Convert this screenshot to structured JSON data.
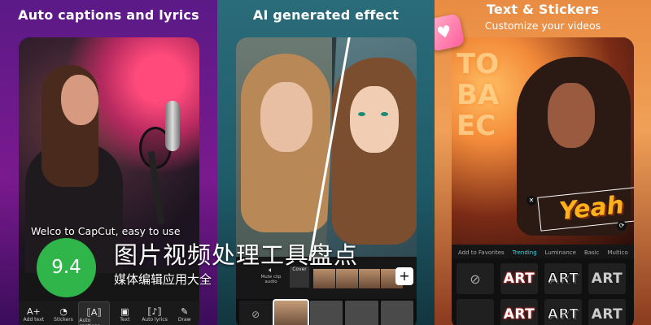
{
  "panels": [
    {
      "title": "Auto captions and lyrics",
      "caption_text": "Welco   to CapCut, easy to use",
      "toolbar": [
        {
          "icon": "text-add-icon",
          "glyph": "A+",
          "label": "Add text"
        },
        {
          "icon": "sticker-icon",
          "glyph": "◔",
          "label": "Stickers"
        },
        {
          "icon": "auto-captions-icon",
          "glyph": "⟦A⟧",
          "label": "Auto captions"
        },
        {
          "icon": "text-icon",
          "glyph": "▣",
          "label": "Text"
        },
        {
          "icon": "auto-lyrics-icon",
          "glyph": "⟦♪⟧",
          "label": "Auto lyrics"
        },
        {
          "icon": "draw-icon",
          "glyph": "✎",
          "label": "Draw"
        }
      ]
    },
    {
      "title": "AI generated effect",
      "mute_label": "Mute clip audio",
      "cover_label": "Cover"
    },
    {
      "title": "Text & Stickers",
      "subtitle": "Customize your videos",
      "sticker_text": "Yeah",
      "tabs": [
        "Add to Favorites",
        "Trending",
        "Luminance",
        "Basic",
        "Multico"
      ],
      "active_tab": "Trending",
      "art_label": "ART"
    }
  ],
  "overlay": {
    "rating": "9.4",
    "title": "图片视频处理工具盘点",
    "subtitle": "媒体编辑应用大全"
  },
  "colors": {
    "rating_badge": "#2fb54a",
    "active_tab": "#3fd6e6",
    "sticker_yellow": "#ffb11a"
  }
}
